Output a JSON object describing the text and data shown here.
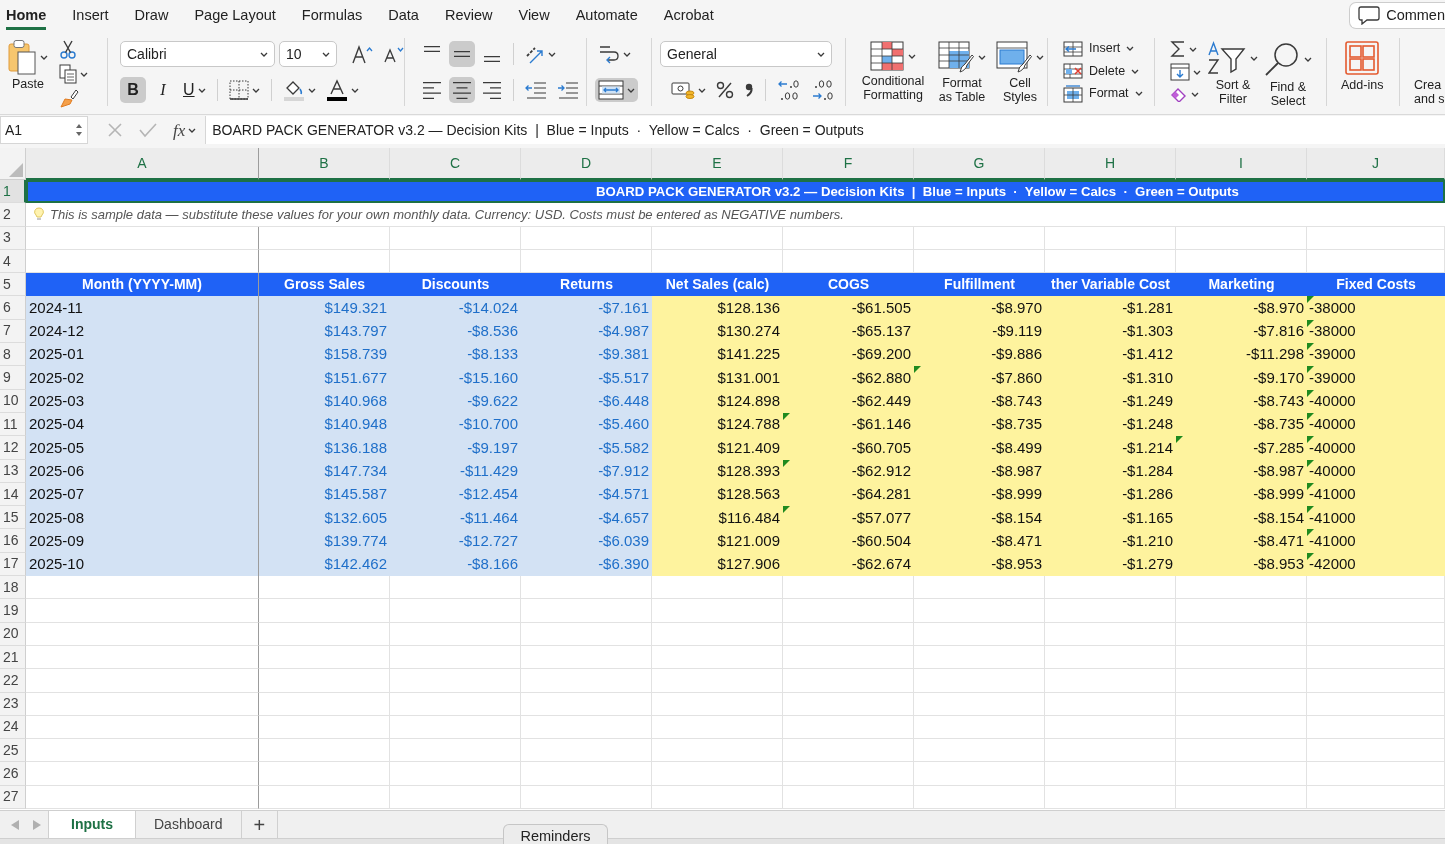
{
  "ribbon": {
    "tabs": [
      {
        "label": "Home",
        "selected": true
      },
      {
        "label": "Insert",
        "selected": false
      },
      {
        "label": "Draw",
        "selected": false
      },
      {
        "label": "Page Layout",
        "selected": false
      },
      {
        "label": "Formulas",
        "selected": false
      },
      {
        "label": "Data",
        "selected": false
      },
      {
        "label": "Review",
        "selected": false
      },
      {
        "label": "View",
        "selected": false
      },
      {
        "label": "Automate",
        "selected": false
      },
      {
        "label": "Acrobat",
        "selected": false
      }
    ],
    "comments_button": "Commen",
    "clipboard": {
      "paste_label": "Paste"
    },
    "font": {
      "name": "Calibri",
      "size": "10",
      "style_buttons": [
        {
          "kind": "bold",
          "label": "B",
          "selected": true
        },
        {
          "kind": "italic",
          "label": "I",
          "selected": false
        },
        {
          "kind": "underline",
          "label": "U",
          "selected": false
        }
      ]
    },
    "alignment": {
      "vertical": [
        {
          "kind": "top",
          "selected": false
        },
        {
          "kind": "middle",
          "selected": true
        },
        {
          "kind": "bottom",
          "selected": false
        }
      ],
      "horizontal": [
        {
          "kind": "left",
          "selected": false
        },
        {
          "kind": "center",
          "selected": true
        },
        {
          "kind": "right",
          "selected": false
        }
      ]
    },
    "merge_and_center": {
      "selected": true
    },
    "number": {
      "format": "General"
    },
    "styles": [
      {
        "kind": "conditional",
        "label": "Conditional Formatting"
      },
      {
        "kind": "table",
        "label": "Format as Table"
      },
      {
        "kind": "cellstyles",
        "label": "Cell Styles"
      }
    ],
    "cells": [
      {
        "kind": "insert",
        "label": "Insert"
      },
      {
        "kind": "delete",
        "label": "Delete"
      },
      {
        "kind": "format",
        "label": "Format"
      }
    ],
    "editing": [
      {
        "kind": "sort",
        "label": "Sort & Filter"
      },
      {
        "kind": "find",
        "label": "Find & Select"
      }
    ],
    "add_ins": {
      "label": "Add-ins"
    },
    "create": {
      "label": "Crea and s"
    }
  },
  "formula_bar": {
    "name_box": "A1",
    "function_button": "fx",
    "formula": "BOARD PACK GENERATOR v3.2 — Decision Kits  |  Blue = Inputs  ·  Yellow = Calcs  ·  Green = Outputs"
  },
  "sheet": {
    "columns": [
      {
        "letter": "A",
        "selected": true,
        "kind": "label"
      },
      {
        "letter": "B",
        "selected": true,
        "kind": "input"
      },
      {
        "letter": "C",
        "selected": true,
        "kind": "input"
      },
      {
        "letter": "D",
        "selected": true,
        "kind": "input"
      },
      {
        "letter": "E",
        "selected": true,
        "kind": "calc"
      },
      {
        "letter": "F",
        "selected": true,
        "kind": "calc"
      },
      {
        "letter": "G",
        "selected": true,
        "kind": "calc"
      },
      {
        "letter": "H",
        "selected": true,
        "kind": "calc"
      },
      {
        "letter": "I",
        "selected": true,
        "kind": "calc"
      },
      {
        "letter": "J",
        "selected": true,
        "kind": "text"
      }
    ],
    "rows": [
      {
        "number": "1",
        "selected": true,
        "kind": "banner",
        "text": "BOARD PACK GENERATOR v3.2 — Decision Kits  |  Blue = Inputs  ·  Yellow = Calcs  ·  Green = Outputs"
      },
      {
        "number": "2",
        "selected": false,
        "kind": "note",
        "text": "This is sample data — substitute these values for your own monthly data. Currency: USD. Costs must be entered as NEGATIVE numbers."
      },
      {
        "number": "3",
        "selected": false,
        "kind": "empty"
      },
      {
        "number": "4",
        "selected": false,
        "kind": "empty"
      },
      {
        "number": "5",
        "selected": false,
        "kind": "header",
        "cells": [
          "Month (YYYY-MM)",
          "Gross Sales",
          "Discounts",
          "Returns",
          "Net Sales (calc)",
          "COGS",
          "Fulfillment",
          "ther Variable Cost",
          "Marketing",
          "Fixed Costs"
        ]
      },
      {
        "number": "6",
        "selected": false,
        "kind": "data",
        "cells": [
          {
            "text": "2024-11",
            "flagged": false
          },
          {
            "text": "$149.321",
            "flagged": false
          },
          {
            "text": "-$14.024",
            "flagged": false
          },
          {
            "text": "-$7.161",
            "flagged": false
          },
          {
            "text": "$128.136",
            "flagged": false
          },
          {
            "text": "-$61.505",
            "flagged": false
          },
          {
            "text": "-$8.970",
            "flagged": false
          },
          {
            "text": "-$1.281",
            "flagged": false
          },
          {
            "text": "-$8.970",
            "flagged": false
          },
          {
            "text": "-38000",
            "flagged": true
          }
        ]
      },
      {
        "number": "7",
        "selected": false,
        "kind": "data",
        "cells": [
          {
            "text": "2024-12",
            "flagged": false
          },
          {
            "text": "$143.797",
            "flagged": false
          },
          {
            "text": "-$8.536",
            "flagged": false
          },
          {
            "text": "-$4.987",
            "flagged": false
          },
          {
            "text": "$130.274",
            "flagged": false
          },
          {
            "text": "-$65.137",
            "flagged": false
          },
          {
            "text": "-$9.119",
            "flagged": false
          },
          {
            "text": "-$1.303",
            "flagged": false
          },
          {
            "text": "-$7.816",
            "flagged": false
          },
          {
            "text": "-38000",
            "flagged": true
          }
        ]
      },
      {
        "number": "8",
        "selected": false,
        "kind": "data",
        "cells": [
          {
            "text": "2025-01",
            "flagged": false
          },
          {
            "text": "$158.739",
            "flagged": false
          },
          {
            "text": "-$8.133",
            "flagged": false
          },
          {
            "text": "-$9.381",
            "flagged": false
          },
          {
            "text": "$141.225",
            "flagged": false
          },
          {
            "text": "-$69.200",
            "flagged": false
          },
          {
            "text": "-$9.886",
            "flagged": false
          },
          {
            "text": "-$1.412",
            "flagged": false
          },
          {
            "text": "-$11.298",
            "flagged": false
          },
          {
            "text": "-39000",
            "flagged": true
          }
        ]
      },
      {
        "number": "9",
        "selected": false,
        "kind": "data",
        "cells": [
          {
            "text": "2025-02",
            "flagged": false
          },
          {
            "text": "$151.677",
            "flagged": false
          },
          {
            "text": "-$15.160",
            "flagged": false
          },
          {
            "text": "-$5.517",
            "flagged": false
          },
          {
            "text": "$131.001",
            "flagged": false
          },
          {
            "text": "-$62.880",
            "flagged": false
          },
          {
            "text": "-$7.860",
            "flagged": true
          },
          {
            "text": "-$1.310",
            "flagged": false
          },
          {
            "text": "-$9.170",
            "flagged": false
          },
          {
            "text": "-39000",
            "flagged": true
          }
        ]
      },
      {
        "number": "10",
        "selected": false,
        "kind": "data",
        "cells": [
          {
            "text": "2025-03",
            "flagged": false
          },
          {
            "text": "$140.968",
            "flagged": false
          },
          {
            "text": "-$9.622",
            "flagged": false
          },
          {
            "text": "-$6.448",
            "flagged": false
          },
          {
            "text": "$124.898",
            "flagged": false
          },
          {
            "text": "-$62.449",
            "flagged": false
          },
          {
            "text": "-$8.743",
            "flagged": false
          },
          {
            "text": "-$1.249",
            "flagged": false
          },
          {
            "text": "-$8.743",
            "flagged": false
          },
          {
            "text": "-40000",
            "flagged": true
          }
        ]
      },
      {
        "number": "11",
        "selected": false,
        "kind": "data",
        "cells": [
          {
            "text": "2025-04",
            "flagged": false
          },
          {
            "text": "$140.948",
            "flagged": false
          },
          {
            "text": "-$10.700",
            "flagged": false
          },
          {
            "text": "-$5.460",
            "flagged": false
          },
          {
            "text": "$124.788",
            "flagged": false
          },
          {
            "text": "-$61.146",
            "flagged": true
          },
          {
            "text": "-$8.735",
            "flagged": false
          },
          {
            "text": "-$1.248",
            "flagged": false
          },
          {
            "text": "-$8.735",
            "flagged": false
          },
          {
            "text": "-40000",
            "flagged": true
          }
        ]
      },
      {
        "number": "12",
        "selected": false,
        "kind": "data",
        "cells": [
          {
            "text": "2025-05",
            "flagged": false
          },
          {
            "text": "$136.188",
            "flagged": false
          },
          {
            "text": "-$9.197",
            "flagged": false
          },
          {
            "text": "-$5.582",
            "flagged": false
          },
          {
            "text": "$121.409",
            "flagged": false
          },
          {
            "text": "-$60.705",
            "flagged": false
          },
          {
            "text": "-$8.499",
            "flagged": false
          },
          {
            "text": "-$1.214",
            "flagged": false
          },
          {
            "text": "-$7.285",
            "flagged": true
          },
          {
            "text": "-40000",
            "flagged": true
          }
        ]
      },
      {
        "number": "13",
        "selected": false,
        "kind": "data",
        "cells": [
          {
            "text": "2025-06",
            "flagged": false
          },
          {
            "text": "$147.734",
            "flagged": false
          },
          {
            "text": "-$11.429",
            "flagged": false
          },
          {
            "text": "-$7.912",
            "flagged": false
          },
          {
            "text": "$128.393",
            "flagged": false
          },
          {
            "text": "-$62.912",
            "flagged": true
          },
          {
            "text": "-$8.987",
            "flagged": false
          },
          {
            "text": "-$1.284",
            "flagged": false
          },
          {
            "text": "-$8.987",
            "flagged": false
          },
          {
            "text": "-40000",
            "flagged": true
          }
        ]
      },
      {
        "number": "14",
        "selected": false,
        "kind": "data",
        "cells": [
          {
            "text": "2025-07",
            "flagged": false
          },
          {
            "text": "$145.587",
            "flagged": false
          },
          {
            "text": "-$12.454",
            "flagged": false
          },
          {
            "text": "-$4.571",
            "flagged": false
          },
          {
            "text": "$128.563",
            "flagged": false
          },
          {
            "text": "-$64.281",
            "flagged": false
          },
          {
            "text": "-$8.999",
            "flagged": false
          },
          {
            "text": "-$1.286",
            "flagged": false
          },
          {
            "text": "-$8.999",
            "flagged": false
          },
          {
            "text": "-41000",
            "flagged": true
          }
        ]
      },
      {
        "number": "15",
        "selected": false,
        "kind": "data",
        "cells": [
          {
            "text": "2025-08",
            "flagged": false
          },
          {
            "text": "$132.605",
            "flagged": false
          },
          {
            "text": "-$11.464",
            "flagged": false
          },
          {
            "text": "-$4.657",
            "flagged": false
          },
          {
            "text": "$116.484",
            "flagged": false
          },
          {
            "text": "-$57.077",
            "flagged": true
          },
          {
            "text": "-$8.154",
            "flagged": false
          },
          {
            "text": "-$1.165",
            "flagged": false
          },
          {
            "text": "-$8.154",
            "flagged": false
          },
          {
            "text": "-41000",
            "flagged": true
          }
        ]
      },
      {
        "number": "16",
        "selected": false,
        "kind": "data",
        "cells": [
          {
            "text": "2025-09",
            "flagged": false
          },
          {
            "text": "$139.774",
            "flagged": false
          },
          {
            "text": "-$12.727",
            "flagged": false
          },
          {
            "text": "-$6.039",
            "flagged": false
          },
          {
            "text": "$121.009",
            "flagged": false
          },
          {
            "text": "-$60.504",
            "flagged": false
          },
          {
            "text": "-$8.471",
            "flagged": false
          },
          {
            "text": "-$1.210",
            "flagged": false
          },
          {
            "text": "-$8.471",
            "flagged": false
          },
          {
            "text": "-41000",
            "flagged": true
          }
        ]
      },
      {
        "number": "17",
        "selected": false,
        "kind": "data",
        "cells": [
          {
            "text": "2025-10",
            "flagged": false
          },
          {
            "text": "$142.462",
            "flagged": false
          },
          {
            "text": "-$8.166",
            "flagged": false
          },
          {
            "text": "-$6.390",
            "flagged": false
          },
          {
            "text": "$127.906",
            "flagged": false
          },
          {
            "text": "-$62.674",
            "flagged": false
          },
          {
            "text": "-$8.953",
            "flagged": false
          },
          {
            "text": "-$1.279",
            "flagged": false
          },
          {
            "text": "-$8.953",
            "flagged": false
          },
          {
            "text": "-42000",
            "flagged": true
          }
        ]
      },
      {
        "number": "18",
        "selected": false,
        "kind": "empty"
      },
      {
        "number": "19",
        "selected": false,
        "kind": "empty"
      },
      {
        "number": "20",
        "selected": false,
        "kind": "empty"
      },
      {
        "number": "21",
        "selected": false,
        "kind": "empty"
      },
      {
        "number": "22",
        "selected": false,
        "kind": "empty"
      },
      {
        "number": "23",
        "selected": false,
        "kind": "empty"
      },
      {
        "number": "24",
        "selected": false,
        "kind": "empty"
      },
      {
        "number": "25",
        "selected": false,
        "kind": "empty"
      },
      {
        "number": "26",
        "selected": false,
        "kind": "empty"
      },
      {
        "number": "27",
        "selected": false,
        "kind": "empty"
      }
    ]
  },
  "sheet_tabs": {
    "tabs": [
      {
        "label": "Inputs",
        "selected": true
      },
      {
        "label": "Dashboard",
        "selected": false
      }
    ],
    "add_button": "+"
  },
  "reminders_button": "Reminders"
}
